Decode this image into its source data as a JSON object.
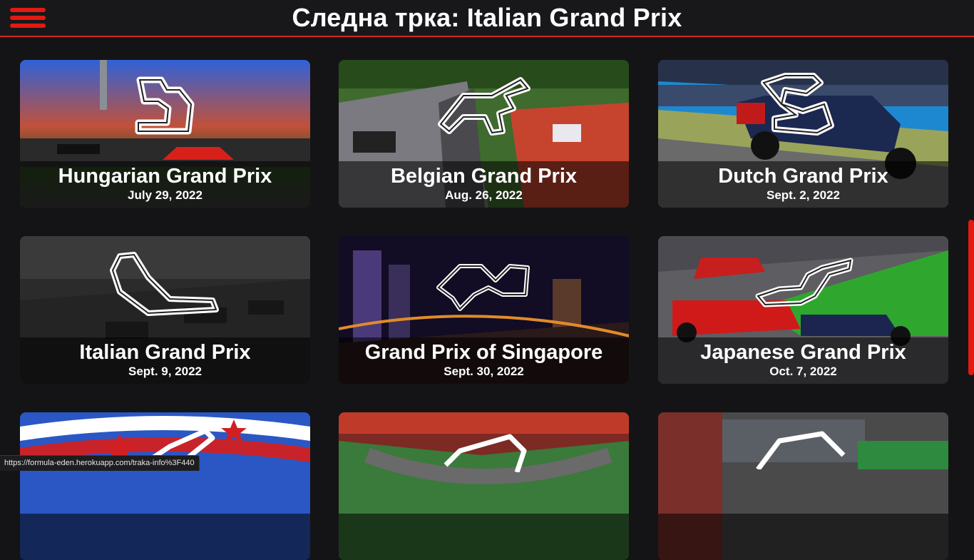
{
  "header": {
    "title": "Следна трка: Italian Grand Prix",
    "menu_icon": "hamburger-menu-icon",
    "accent_color": "#e11a12"
  },
  "races": [
    {
      "name": "Hungarian Grand Prix",
      "date": "July 29, 2022"
    },
    {
      "name": "Belgian Grand Prix",
      "date": "Aug. 26, 2022"
    },
    {
      "name": "Dutch Grand Prix",
      "date": "Sept. 2, 2022"
    },
    {
      "name": "Italian Grand Prix",
      "date": "Sept. 9, 2022"
    },
    {
      "name": "Grand Prix of Singapore",
      "date": "Sept. 30, 2022"
    },
    {
      "name": "Japanese Grand Prix",
      "date": "Oct. 7, 2022"
    },
    {
      "name": "",
      "date": ""
    },
    {
      "name": "",
      "date": ""
    },
    {
      "name": "",
      "date": ""
    }
  ],
  "status_bar": {
    "url": "https://formula-eden.herokuapp.com/traka-info%3F440"
  }
}
